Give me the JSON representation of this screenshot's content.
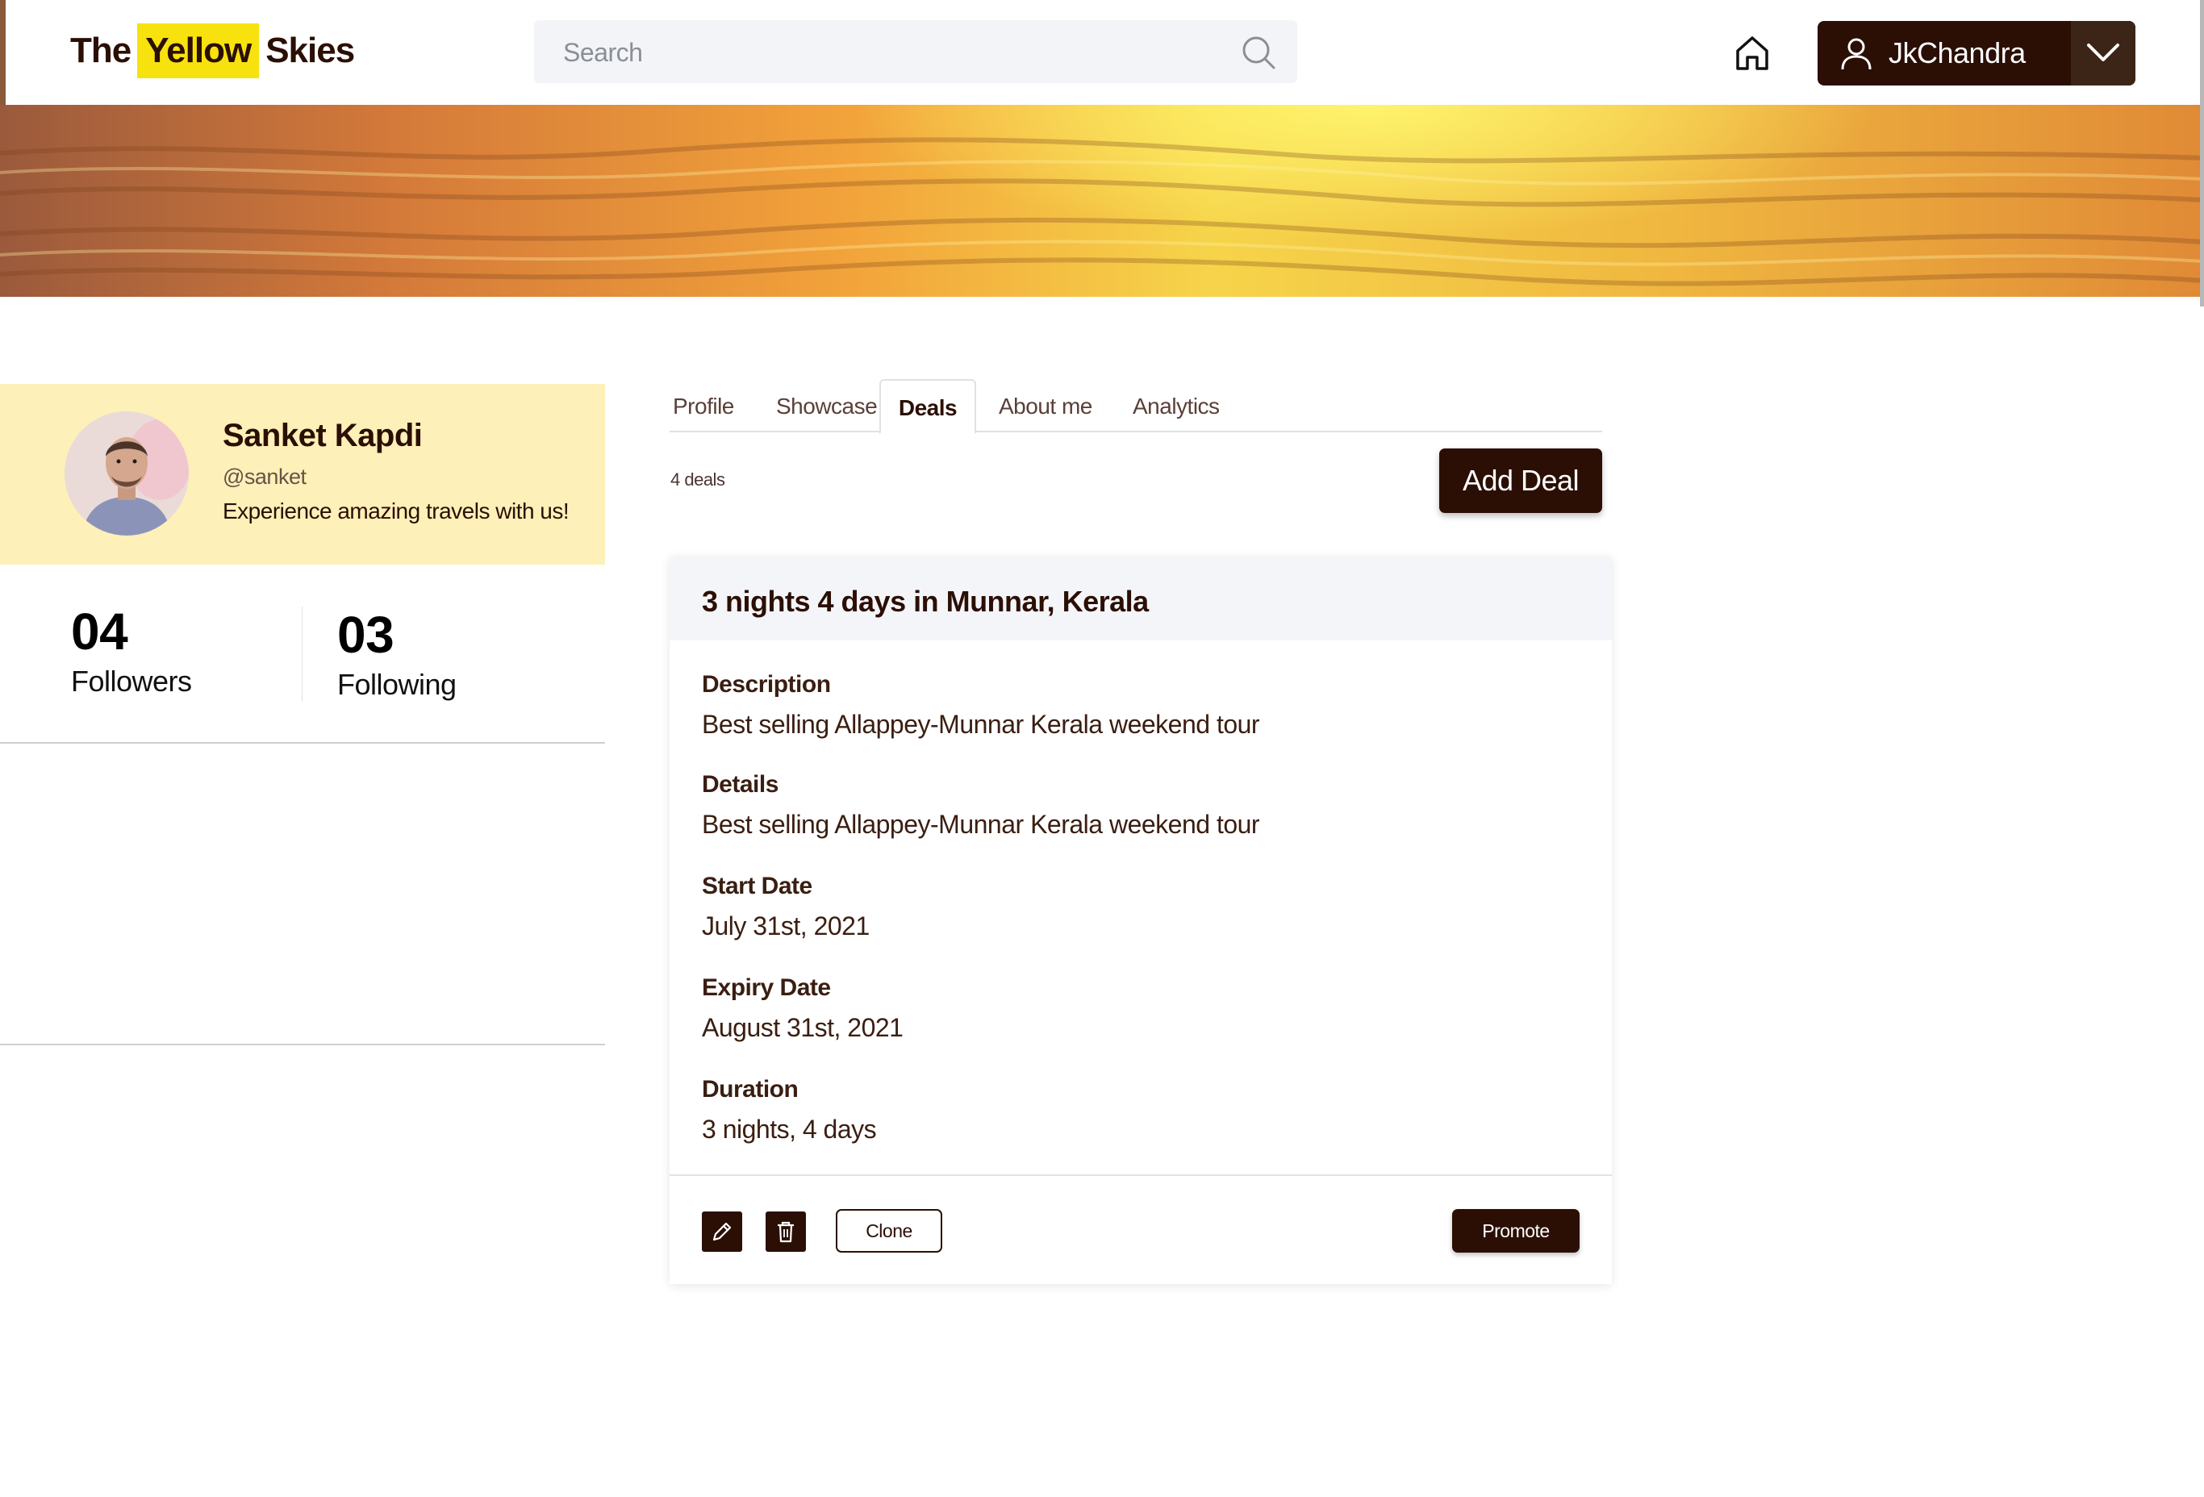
{
  "header": {
    "logo": {
      "part1": "The",
      "highlight": "Yellow",
      "part2": "Skies"
    },
    "search": {
      "placeholder": "Search",
      "value": ""
    },
    "user": {
      "name": "JkChandra"
    }
  },
  "profile": {
    "name": "Sanket Kapdi",
    "handle": "@sanket",
    "bio": "Experience amazing travels with us!",
    "followers": {
      "count": "04",
      "label": "Followers"
    },
    "following": {
      "count": "03",
      "label": "Following"
    }
  },
  "tabs": [
    {
      "label": "Profile"
    },
    {
      "label": "Showcase"
    },
    {
      "label": "Deals"
    },
    {
      "label": "About me"
    },
    {
      "label": "Analytics"
    }
  ],
  "active_tab": "Deals",
  "deals": {
    "count_label": "4 deals",
    "add_label": "Add Deal",
    "card": {
      "title": "3 nights 4 days in Munnar, Kerala",
      "fields": [
        {
          "label": "Description",
          "value": "Best selling Allappey-Munnar Kerala weekend tour"
        },
        {
          "label": "Details",
          "value": "Best selling Allappey-Munnar Kerala weekend tour"
        },
        {
          "label": "Start Date",
          "value": "July 31st, 2021"
        },
        {
          "label": "Expiry Date",
          "value": "August 31st, 2021"
        },
        {
          "label": "Duration",
          "value": "3 nights, 4 days"
        }
      ],
      "actions": {
        "clone": "Clone",
        "promote": "Promote"
      }
    }
  },
  "colors": {
    "brand_dark": "#2b0f05",
    "brand_yellow": "#f7e20e",
    "profile_bg": "#fdf0b8"
  },
  "icons": [
    "search-icon",
    "home-icon",
    "user-icon",
    "chevron-down-icon",
    "pencil-icon",
    "trash-icon"
  ]
}
